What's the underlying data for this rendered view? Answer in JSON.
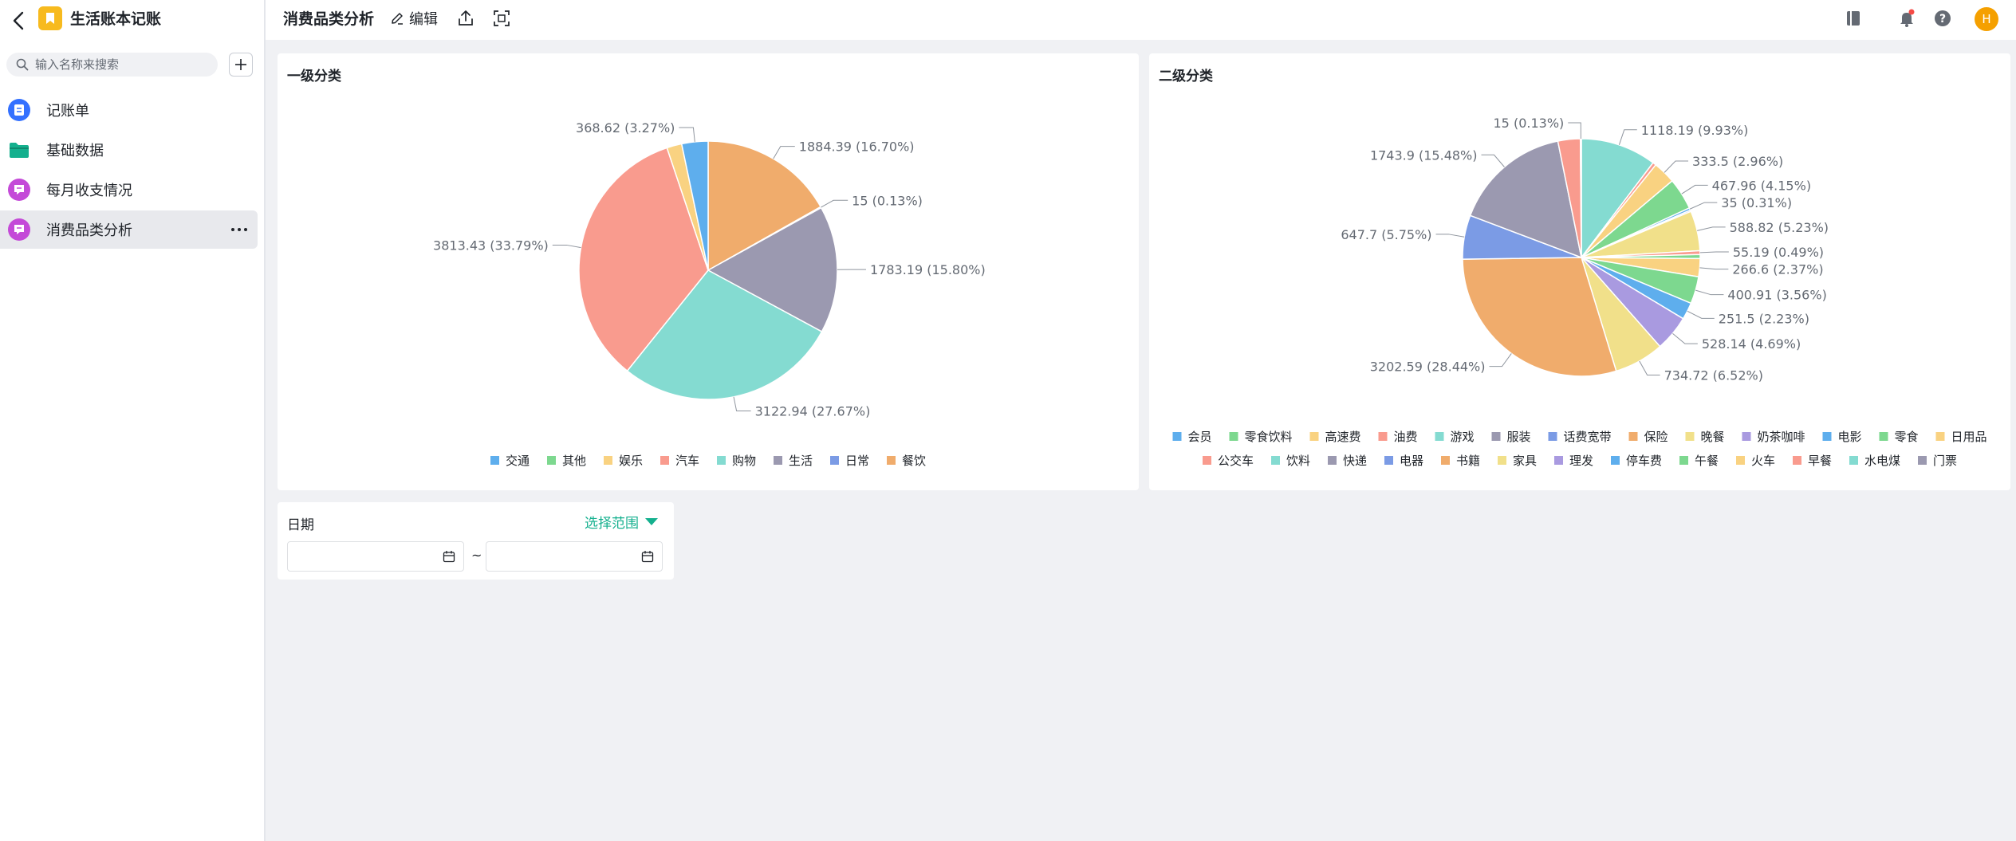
{
  "app": {
    "title": "生活账本记账"
  },
  "search": {
    "placeholder": "输入名称来搜索"
  },
  "sidebar": {
    "items": [
      {
        "label": "记账单",
        "icon": "form-icon",
        "color": "#3370ff"
      },
      {
        "label": "基础数据",
        "icon": "folder-icon",
        "color": "#14b08e"
      },
      {
        "label": "每月收支情况",
        "icon": "chart-icon",
        "color": "#c44ad8"
      },
      {
        "label": "消费品类分析",
        "icon": "chart-icon",
        "color": "#c44ad8",
        "active": true
      }
    ]
  },
  "topbar": {
    "page_title": "消费品类分析",
    "edit_label": "编辑",
    "avatar_letter": "H"
  },
  "date_filter": {
    "label": "日期",
    "range_label": "选择范围",
    "separator": "~"
  },
  "colors": {
    "accent": "#14b08e",
    "app_icon": "#f7ba1e",
    "avatar": "#f5a000"
  },
  "chart_data": [
    {
      "type": "pie",
      "title": "一级分类",
      "legend_position": "bottom",
      "categories": [
        "交通",
        "其他",
        "娱乐",
        "汽车",
        "购物",
        "生活",
        "日常",
        "餐饮"
      ],
      "legend_colors": [
        "#5eaeed",
        "#7dd88f",
        "#f9d281",
        "#f99b8e",
        "#84dbd1",
        "#9b99b0",
        "#7b9be5",
        "#f0ac6c"
      ],
      "slices": [
        {
          "name": "餐饮",
          "value": 1884.39,
          "label": "1884.39 (16.70%)",
          "color": "#f0ac6c"
        },
        {
          "name": "日常",
          "value": 15,
          "label": "15 (0.13%)",
          "color": "#7b9be5"
        },
        {
          "name": "生活",
          "value": 1783.19,
          "label": "1783.19 (15.80%)",
          "color": "#9b99b0"
        },
        {
          "name": "购物",
          "value": 3122.94,
          "label": "3122.94 (27.67%)",
          "color": "#84dbd1"
        },
        {
          "name": "汽车",
          "value": 3813.43,
          "label": "3813.43 (33.79%)",
          "color": "#f99b8e"
        },
        {
          "name": "娱乐",
          "value": 210.0,
          "label": "",
          "color": "#f9d281"
        },
        {
          "name": "交通",
          "value": 368.62,
          "label": "368.62 (3.27%)",
          "color": "#5eaeed"
        }
      ]
    },
    {
      "type": "pie",
      "title": "二级分类",
      "legend_position": "bottom",
      "legend_rows": [
        [
          "会员",
          "零食饮料",
          "高速费",
          "油费",
          "游戏",
          "服装",
          "话费宽带",
          "保险",
          "晚餐",
          "奶茶咖啡",
          "电影",
          "零食",
          "日用品"
        ],
        [
          "公交车",
          "饮料",
          "快递",
          "电器",
          "书籍",
          "家具",
          "理发",
          "停车费",
          "午餐",
          "火车",
          "早餐",
          "水电煤",
          "门票"
        ]
      ],
      "legend_colors": [
        [
          "#5eaeed",
          "#7dd88f",
          "#f9d281",
          "#f99b8e",
          "#84dbd1",
          "#9b99b0",
          "#7b9be5",
          "#f0ac6c",
          "#f1e08a",
          "#a99ae0",
          "#5eaeed",
          "#7dd88f",
          "#f9d281"
        ],
        [
          "#f99b8e",
          "#84dbd1",
          "#9b99b0",
          "#7b9be5",
          "#f0ac6c",
          "#f1e08a",
          "#a99ae0",
          "#5eaeed",
          "#7dd88f",
          "#f9d281",
          "#f99b8e",
          "#84dbd1",
          "#9b99b0"
        ]
      ],
      "slices": [
        {
          "value": 1118.19,
          "label": "1118.19 (9.93%)",
          "color": "#84dbd1"
        },
        {
          "value": 50,
          "label": "",
          "color": "#f99b8e"
        },
        {
          "value": 333.5,
          "label": "333.5 (2.96%)",
          "color": "#f9d281"
        },
        {
          "value": 467.96,
          "label": "467.96 (4.15%)",
          "color": "#7dd88f"
        },
        {
          "value": 35,
          "label": "35 (0.31%)",
          "color": "#5eaeed"
        },
        {
          "value": 20,
          "label": "",
          "color": "#a99ae0"
        },
        {
          "value": 588.82,
          "label": "588.82 (5.23%)",
          "color": "#f1e08a"
        },
        {
          "value": 55.19,
          "label": "55.19 (0.49%)",
          "color": "#f99b8e"
        },
        {
          "value": 60,
          "label": "",
          "color": "#7dd88f"
        },
        {
          "value": 266.6,
          "label": "266.6 (2.37%)",
          "color": "#f9d281"
        },
        {
          "value": 400.91,
          "label": "400.91 (3.56%)",
          "color": "#7dd88f"
        },
        {
          "value": 251.5,
          "label": "251.5 (2.23%)",
          "color": "#5eaeed"
        },
        {
          "value": 528.14,
          "label": "528.14 (4.69%)",
          "color": "#a99ae0"
        },
        {
          "value": 734.72,
          "label": "734.72 (6.52%)",
          "color": "#f1e08a"
        },
        {
          "value": 3202.59,
          "label": "3202.59 (28.44%)",
          "color": "#f0ac6c"
        },
        {
          "value": 647.7,
          "label": "647.7 (5.75%)",
          "color": "#7b9be5"
        },
        {
          "value": 1743.9,
          "label": "1743.9 (15.48%)",
          "color": "#9b99b0"
        },
        {
          "value": 330,
          "label": "",
          "color": "#f99b8e"
        },
        {
          "value": 15,
          "label": "15 (0.13%)",
          "color": "#84dbd1"
        }
      ]
    }
  ]
}
